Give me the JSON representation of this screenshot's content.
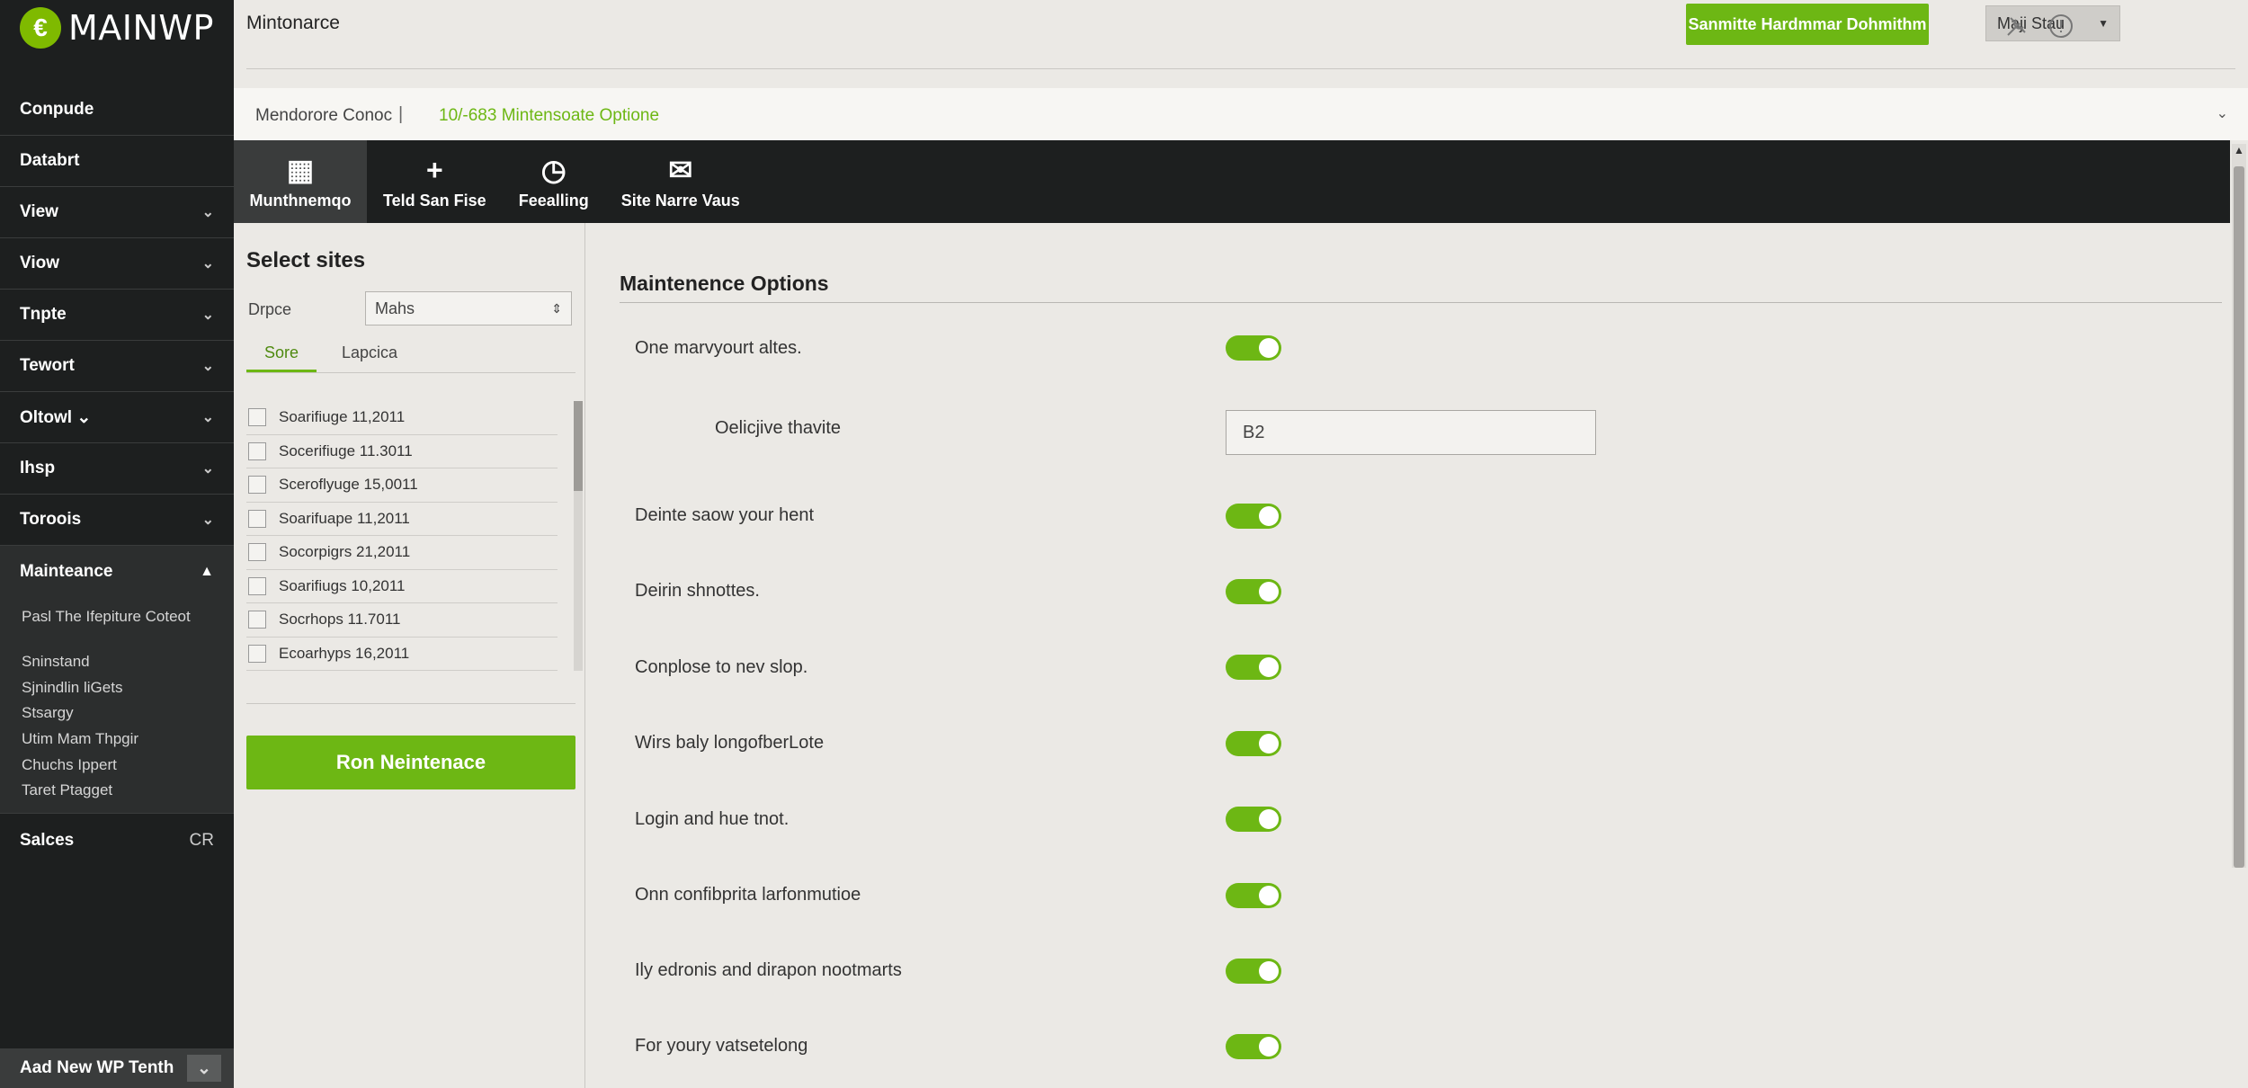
{
  "app": {
    "logo_mark": "€",
    "logo_text": "MAINWP"
  },
  "header": {
    "page_title": "Mintonarce",
    "primary_button": "Sanmitte Hardmmar Dohmithm",
    "site_select": "Maji Stau",
    "icons": [
      "tools-icon",
      "help-icon"
    ]
  },
  "breadcrumb": {
    "item1": "Mendorore Conoc",
    "separator": "|",
    "item2": "10/-683 Mintensoate Optione",
    "caret": "⌄"
  },
  "sidebar": {
    "items": [
      {
        "label": "Conpude",
        "chevron": ""
      },
      {
        "label": "Databrt",
        "chevron": ""
      },
      {
        "label": "View",
        "chevron": "⌄"
      },
      {
        "label": "Viow",
        "chevron": "⌄"
      },
      {
        "label": "Tnpte",
        "chevron": "⌄"
      },
      {
        "label": "Tewort",
        "chevron": "⌄"
      },
      {
        "label": "Oltowl ⌄",
        "chevron": "⌄"
      },
      {
        "label": "Ihsp",
        "chevron": "⌄"
      },
      {
        "label": "Toroois",
        "chevron": "⌄"
      }
    ],
    "active": {
      "label": "Mainteance",
      "chevron": "▲"
    },
    "submenu": [
      "Pasl The Ifepiture Coteot",
      "Sninstand",
      "Sjnindlin liGets",
      "Stsargy",
      "Utim Mam Thpgir",
      "Chuchs Ippert",
      "Taret Ptagget"
    ],
    "sales": {
      "label": "Salces",
      "right": "CR"
    },
    "footer": {
      "label": "Aad New WP Tenth",
      "button": "⌄"
    }
  },
  "toolbar": {
    "items": [
      {
        "label": "Munthnemqo",
        "icon": "▦"
      },
      {
        "label": "Teld San Fise",
        "icon": "+"
      },
      {
        "label": "Feealling",
        "icon": "◷"
      },
      {
        "label": "Site Narre Vaus",
        "icon": "✉"
      }
    ]
  },
  "left_panel": {
    "title": "Select sites",
    "filter_label": "Drpce",
    "filter_value": "Mahs",
    "tabs": [
      "Sore",
      "Lapcica"
    ],
    "sites": [
      "Soarifiuge 11,2011",
      "Socerifiuge 11.3011",
      "Sceroflyuge 15,0011",
      "Soarifuape 11,2011",
      "Socorpigrs 21,2011",
      "Soarifiugs 10,2011",
      "Socrhops 11.7011",
      "Ecoarhyps 16,2011"
    ],
    "run_button": "Ron Neintenace"
  },
  "main": {
    "title": "Maintenence Options",
    "options": [
      {
        "label": "One marvyourt altes.",
        "type": "toggle",
        "on": true
      },
      {
        "label": "Oelicjive thavite",
        "type": "input",
        "value": "B2"
      },
      {
        "label": "Deinte saow your hent",
        "type": "toggle",
        "on": true
      },
      {
        "label": "Deirin shnottes.",
        "type": "toggle",
        "on": true
      },
      {
        "label": "Conplose to nev slop.",
        "type": "toggle",
        "on": true
      },
      {
        "label": "Wirs baly longofberLote",
        "type": "toggle",
        "on": true
      },
      {
        "label": "Login and hue tnot.",
        "type": "toggle",
        "on": true
      },
      {
        "label": "Onn confibprita larfonmutioe",
        "type": "toggle",
        "on": true
      },
      {
        "label": "Ily edronis and dirapon nootmarts",
        "type": "toggle",
        "on": true
      },
      {
        "label": "For youry vatsetelong",
        "type": "toggle",
        "on": true
      }
    ]
  },
  "colors": {
    "accent": "#6db714",
    "sidebar_bg": "#1d1f1f",
    "page_bg": "#ebe9e5"
  }
}
